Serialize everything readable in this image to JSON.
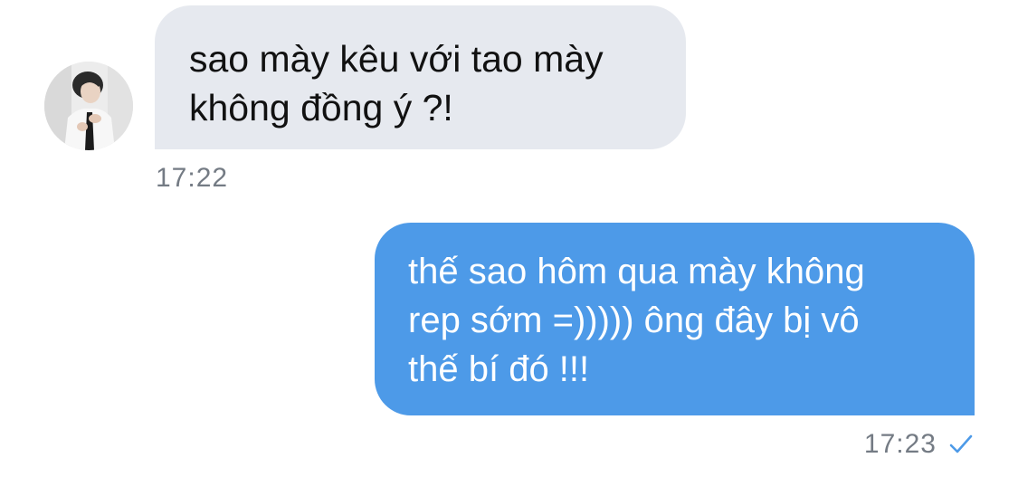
{
  "chat": {
    "messages": [
      {
        "direction": "incoming",
        "text": "sao mày kêu với tao mày\nkhông đồng ý ?!",
        "time": "17:22"
      },
      {
        "direction": "outgoing",
        "text": "thế sao hôm qua mày không\nrep sớm =))))) ông đây bị vô\nthế bí đó !!!",
        "time": "17:23",
        "status_icon": "checkmark-icon"
      }
    ]
  },
  "colors": {
    "incoming_bubble": "#e6e9ef",
    "outgoing_bubble": "#4d9ae8",
    "timestamp": "#747b84",
    "check": "#4d9ae8"
  }
}
